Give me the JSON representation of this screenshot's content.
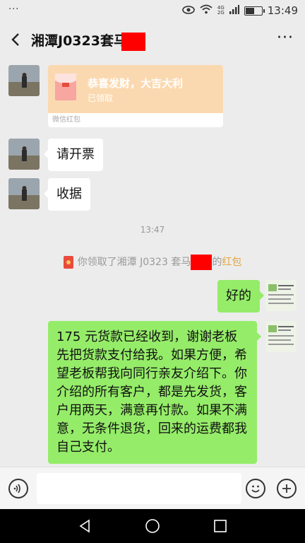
{
  "status_bar": {
    "menu_dots": "···",
    "signal_top": "4G",
    "signal_bottom": "2G",
    "time": "13:49",
    "battery_level": 0.6
  },
  "header": {
    "title": "湘潭J0323套马",
    "more": "···"
  },
  "messages": {
    "red_packet": {
      "title": "恭喜发财，大吉大利",
      "status": "已领取",
      "footer": "微信红包"
    },
    "invoice_text": "请开票",
    "receipt_text": "收据",
    "timestamp": "13:47",
    "system": {
      "prefix": "你领取了湘潭 J0323 套马",
      "suffix": "的",
      "link": "红包"
    },
    "ok_text": "好的",
    "long_text": "175 元货款已经收到，谢谢老板先把货款支付给我。如果方便，希望老板帮我向同行亲友介绍下。你介绍的所有客户，都是先发货，客户用两天，满意再付款。如果不满意，无条件退货，回来的运费都我自己支付。"
  },
  "input_bar": {
    "placeholder": ""
  },
  "icons": {
    "back": "chevron-left-icon",
    "voice": "voice-icon",
    "emoji": "emoji-icon",
    "plus": "plus-icon",
    "nav_back": "triangle-back-icon",
    "nav_home": "circle-home-icon",
    "nav_recent": "square-recent-icon"
  },
  "colors": {
    "green_bubble": "#95ec69",
    "red_packet": "#fbd9b0",
    "link": "#e2a640",
    "redaction": "#ff0000"
  }
}
